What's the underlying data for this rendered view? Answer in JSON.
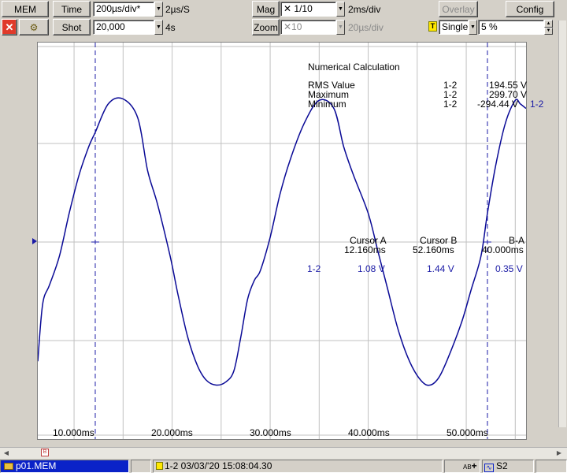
{
  "toolbar": {
    "mem_label": "MEM",
    "time_label": "Time",
    "time_div": "200µs/div*",
    "sample_rate": "2µs/S",
    "mag_label": "Mag",
    "mag_value": "✕ 1/10",
    "mag_div": "2ms/div",
    "overlay_label": "Overlay",
    "config_label": "Config",
    "shot_label": "Shot",
    "shot_value": "20,000",
    "shot_time": "4s",
    "zoom_label": "Zoom",
    "zoom_value": "✕10",
    "zoom_div": "20µs/div",
    "trigger_badge": "T",
    "trigger_mode": "Single",
    "pretrigger": "5 %"
  },
  "measure": {
    "title": "Numerical Calculation",
    "rows": [
      {
        "name": "RMS Value",
        "ch": "1-2",
        "value": "194.55 V"
      },
      {
        "name": "Maximum",
        "ch": "1-2",
        "value": "299.70 V"
      },
      {
        "name": "Minimum",
        "ch": "1-2",
        "value": "-294.44 V"
      }
    ],
    "trace_label": "1-2"
  },
  "cursor": {
    "a_label": "Cursor A",
    "b_label": "Cursor B",
    "ba_label": "B-A",
    "a_time": "12.160ms",
    "b_time": "52.160ms",
    "ba_time": "40.000ms",
    "ch": "1-2",
    "a_val": "1.08 V",
    "b_val": "1.44 V",
    "ba_val": "0.35 V"
  },
  "x_ticks": [
    "10.000ms",
    "20.000ms",
    "30.000ms",
    "40.000ms",
    "50.000ms"
  ],
  "status": {
    "file": "p01.MEM",
    "info": "1-2 03/03/'20 15:08:04.30",
    "ab": "AB",
    "s2": "S2"
  },
  "colors": {
    "trace": "#0a0a96",
    "grid": "#c0c0c0",
    "cursor": "#1a1aa6",
    "file_bg": "#0a22c8"
  },
  "chart_data": {
    "type": "line",
    "x_unit": "ms",
    "xlim": [
      6.3,
      56.1
    ],
    "series": [
      {
        "name": "1-2",
        "x": [
          6.3,
          6.8,
          7.5,
          8.5,
          9.5,
          10.5,
          11.5,
          12.16,
          13.5,
          15.0,
          16.5,
          17.5,
          18.5,
          19.8,
          20.6,
          21.6,
          22.6,
          23.5,
          24.5,
          25.5,
          26.3,
          27.0,
          27.7,
          28.4,
          29.0,
          30.0,
          31.0,
          32.0,
          33.5,
          35.0,
          36.5,
          37.5,
          38.5,
          40.0,
          41.0,
          42.0,
          43.0,
          44.0,
          45.0,
          46.0,
          47.0,
          48.0,
          49.5,
          50.5,
          51.5,
          52.16,
          53.0,
          54.0,
          55.0,
          55.5,
          56.1
        ],
        "y": [
          -250,
          -130,
          -90,
          -30,
          60,
          140,
          200,
          230,
          290,
          300,
          260,
          150,
          80,
          -30,
          -110,
          -200,
          -260,
          -290,
          -300,
          -293,
          -270,
          -200,
          -120,
          -80,
          -60,
          10,
          100,
          170,
          250,
          297,
          280,
          200,
          140,
          60,
          -20,
          -100,
          -180,
          -240,
          -280,
          -300,
          -290,
          -250,
          -170,
          -100,
          -30,
          60,
          160,
          250,
          297,
          290,
          280
        ]
      }
    ]
  }
}
